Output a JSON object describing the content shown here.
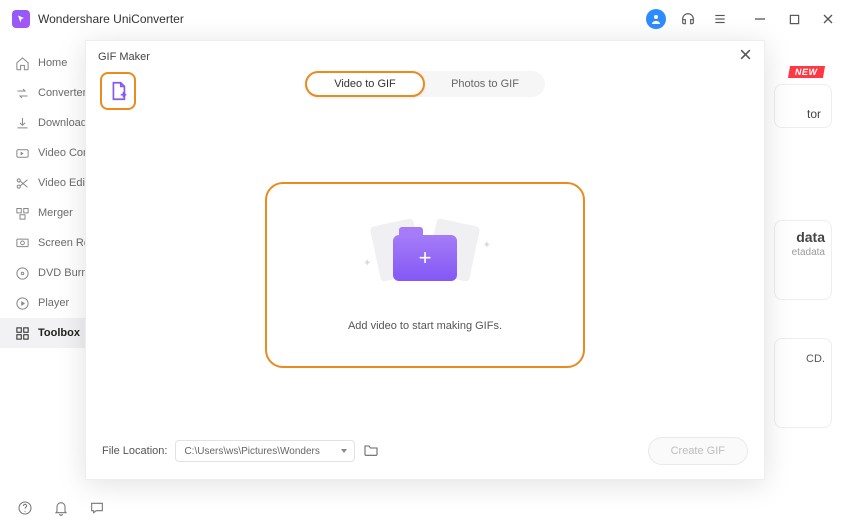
{
  "app": {
    "title": "Wondershare UniConverter"
  },
  "sidebar": {
    "items": [
      {
        "label": "Home"
      },
      {
        "label": "Converter"
      },
      {
        "label": "Downloader"
      },
      {
        "label": "Video Compressor"
      },
      {
        "label": "Video Editor"
      },
      {
        "label": "Merger"
      },
      {
        "label": "Screen Recorder"
      },
      {
        "label": "DVD Burner"
      },
      {
        "label": "Player"
      },
      {
        "label": "Toolbox"
      }
    ]
  },
  "background": {
    "new_badge": "NEW",
    "card_tor_suffix": "tor",
    "data_title": "data",
    "data_sub": "etadata",
    "cd_text": "CD."
  },
  "gifmaker": {
    "title": "GIF Maker",
    "tabs": {
      "video": "Video to GIF",
      "photos": "Photos to GIF"
    },
    "drop_text": "Add video to start making GIFs.",
    "file_location_label": "File Location:",
    "file_location_value": "C:\\Users\\ws\\Pictures\\Wonders",
    "create_btn": "Create GIF"
  }
}
